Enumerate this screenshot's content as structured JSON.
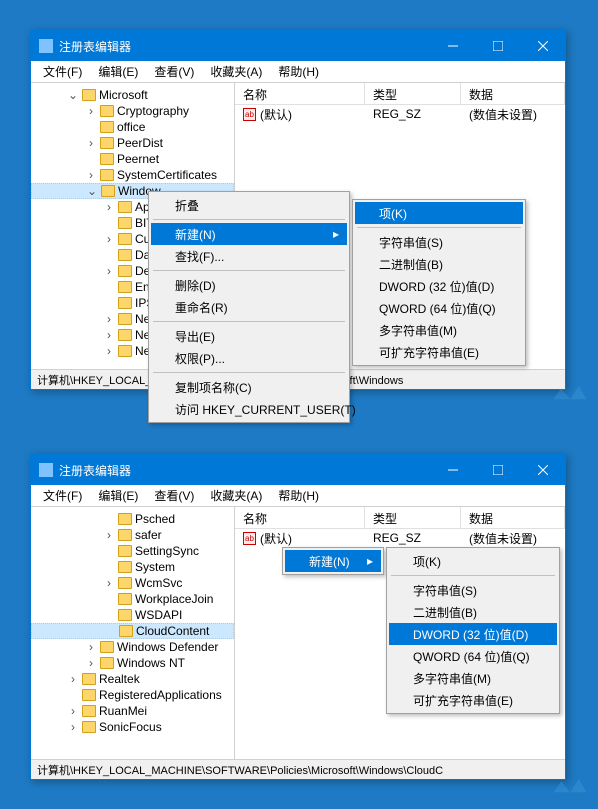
{
  "section1": {
    "title": "注册表编辑器",
    "menu": [
      "文件(F)",
      "编辑(E)",
      "查看(V)",
      "收藏夹(A)",
      "帮助(H)"
    ],
    "tree": {
      "root": "Microsoft",
      "children": [
        "Cryptography",
        "office",
        "PeerDist",
        "Peernet",
        "SystemCertificates"
      ],
      "selected": "Window",
      "sub": [
        "App",
        "BITS",
        "Curr",
        "Data",
        "Deliv",
        "Enha",
        "IPSe",
        "Netw",
        "Netw",
        "Netw"
      ]
    },
    "list": {
      "headers": [
        "名称",
        "类型",
        "数据"
      ],
      "rows": [
        {
          "name": "(默认)",
          "type": "REG_SZ",
          "data": "(数值未设置)"
        }
      ]
    },
    "ctx1": {
      "collapse": "折叠",
      "new": "新建(N)",
      "find": "查找(F)...",
      "delete": "删除(D)",
      "rename": "重命名(R)",
      "export": "导出(E)",
      "perm": "权限(P)...",
      "copykey": "复制项名称(C)",
      "goto": "访问 HKEY_CURRENT_USER(T)"
    },
    "ctx2": {
      "key": "项(K)",
      "string": "字符串值(S)",
      "binary": "二进制值(B)",
      "dword": "DWORD (32 位)值(D)",
      "qword": "QWORD (64 位)值(Q)",
      "multi": "多字符串值(M)",
      "expand": "可扩充字符串值(E)"
    },
    "status": "计算机\\HKEY_LOCAL_MACHINE\\SOFTWARE\\Policies\\Microsoft\\Windows"
  },
  "section2": {
    "title": "注册表编辑器",
    "menu": [
      "文件(F)",
      "编辑(E)",
      "查看(V)",
      "收藏夹(A)",
      "帮助(H)"
    ],
    "tree": {
      "items": [
        "Psched",
        "safer",
        "SettingSync",
        "System",
        "WcmSvc",
        "WorkplaceJoin",
        "WSDAPI"
      ],
      "selected": "CloudContent",
      "siblings": [
        "Windows Defender",
        "Windows NT"
      ],
      "below": [
        "Realtek",
        "RegisteredApplications",
        "RuanMei",
        "SonicFocus"
      ]
    },
    "list": {
      "headers": [
        "名称",
        "类型",
        "数据"
      ],
      "rows": [
        {
          "name": "(默认)",
          "type": "REG_SZ",
          "data": "(数值未设置)"
        }
      ]
    },
    "ctx1": {
      "new": "新建(N)"
    },
    "ctx2": {
      "key": "项(K)",
      "string": "字符串值(S)",
      "binary": "二进制值(B)",
      "dword": "DWORD (32 位)值(D)",
      "qword": "QWORD (64 位)值(Q)",
      "multi": "多字符串值(M)",
      "expand": "可扩充字符串值(E)"
    },
    "status": "计算机\\HKEY_LOCAL_MACHINE\\SOFTWARE\\Policies\\Microsoft\\Windows\\CloudC"
  }
}
